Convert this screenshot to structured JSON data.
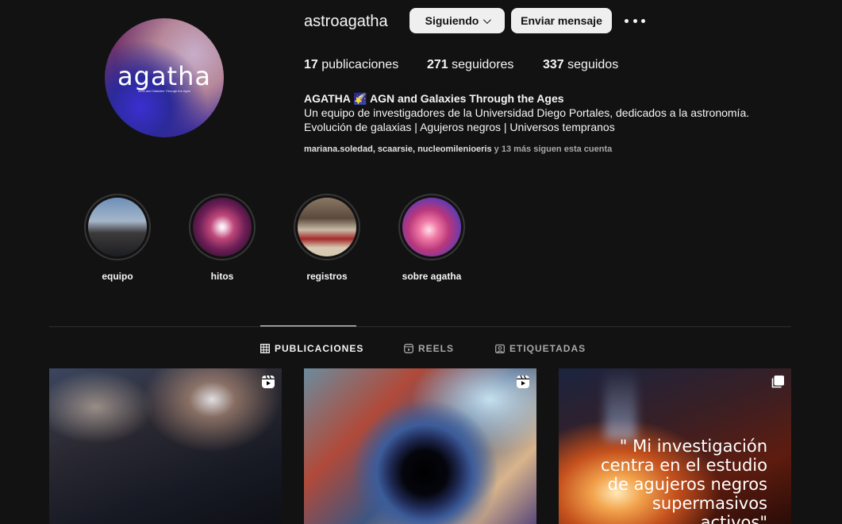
{
  "profile": {
    "username": "astroagatha",
    "avatar_logo": "agatha",
    "avatar_logo_sub": "AGN and Galaxies Through the Ages",
    "follow_button": "Siguiendo",
    "message_button": "Enviar mensaje",
    "more_icon": "more-horizontal-icon"
  },
  "stats": {
    "posts_count": "17",
    "posts_label": " publicaciones",
    "followers_count": "271",
    "followers_label": " seguidores",
    "following_count": "337",
    "following_label": " seguidos"
  },
  "bio": {
    "name": "AGATHA 🌠 AGN and Galaxies Through the Ages",
    "line1": "Un equipo de investigadores de la Universidad Diego Portales, dedicados a la astronomía.",
    "line2": "Evolución de galaxias | Agujeros negros | Universos tempranos",
    "followed_by_names": "mariana.soledad, scaarsie, nucleomilenioeris",
    "followed_by_rest": " y 13 más siguen esta cuenta"
  },
  "highlights": [
    {
      "label": "equipo"
    },
    {
      "label": "hitos"
    },
    {
      "label": "registros"
    },
    {
      "label": "sobre agatha"
    }
  ],
  "tabs": {
    "posts": "PUBLICACIONES",
    "reels": "REELS",
    "tagged": "ETIQUETADAS"
  },
  "posts": [
    {
      "type_icon": "reel-icon"
    },
    {
      "type_icon": "reel-icon"
    },
    {
      "type_icon": "carousel-icon",
      "quote": "\" Mi investigación centra en el estudio de agujeros negros supermasivos activos\""
    }
  ],
  "colors": {
    "background": "#121212",
    "button_bg": "#efefef",
    "secondary_text": "#a8a8a8"
  }
}
